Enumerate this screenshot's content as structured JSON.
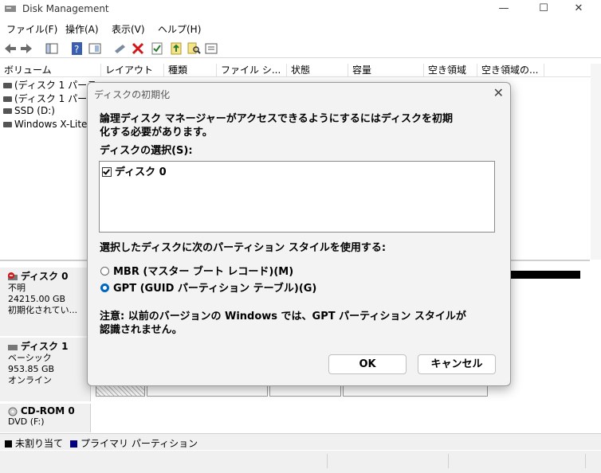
{
  "app": {
    "title": "Disk Management"
  },
  "window_controls": {
    "minimize": "—",
    "maximize": "☐",
    "close": "✕"
  },
  "menu": [
    "ファイル(F)",
    "操作(A)",
    "表示(V)",
    "ヘルプ(H)"
  ],
  "toolbar_icons": [
    "back-icon",
    "forward-icon",
    "console-tree-icon",
    "help-icon",
    "properties-pane-icon",
    "connect-icon",
    "delete-icon",
    "check-icon",
    "import-icon",
    "search-icon",
    "properties-icon"
  ],
  "volume_list": {
    "columns": [
      "ボリューム",
      "レイアウト",
      "種類",
      "ファイル シ...",
      "状態",
      "容量",
      "空き領域",
      "空き領域の..."
    ],
    "rows": [
      "(ディスク 1 パーティ",
      "(ディスク 1 パーテ",
      "SSD (D:)",
      "Windows X-Lite"
    ]
  },
  "disks": [
    {
      "name": "ディスク 0",
      "lines": [
        "不明",
        "24215.00 GB",
        "初期化されてい..."
      ]
    },
    {
      "name": "ディスク 1",
      "lines": [
        "ベーシック",
        "953.85 GB",
        "オンライン"
      ]
    },
    {
      "name": "CD-ROM 0",
      "lines": [
        "DVD (F:)"
      ]
    }
  ],
  "legend": {
    "unallocated": "未割り当て",
    "primary": "プライマリ パーティション"
  },
  "colors": {
    "accent": "#0067c0",
    "unallocated": "#000000",
    "primary": "#000080"
  },
  "dialog": {
    "title": "ディスクの初期化",
    "close": "✕",
    "message_line1": "論理ディスク マネージャーがアクセスできるようにするにはディスクを初期",
    "message_line2": "化する必要があります。",
    "select_label": "ディスクの選択(S):",
    "disk_item": "ディスク 0",
    "partition_style_label": "選択したディスクに次のパーティション スタイルを使用する:",
    "mbr_option": "MBR (マスター ブート レコード)(M)",
    "gpt_option": "GPT (GUID パーティション テーブル)(G)",
    "note_line1": "注意: 以前のバージョンの Windows では、GPT パーティション スタイルが",
    "note_line2": "認識されません。",
    "ok_label": "OK",
    "cancel_label": "キャンセル"
  }
}
